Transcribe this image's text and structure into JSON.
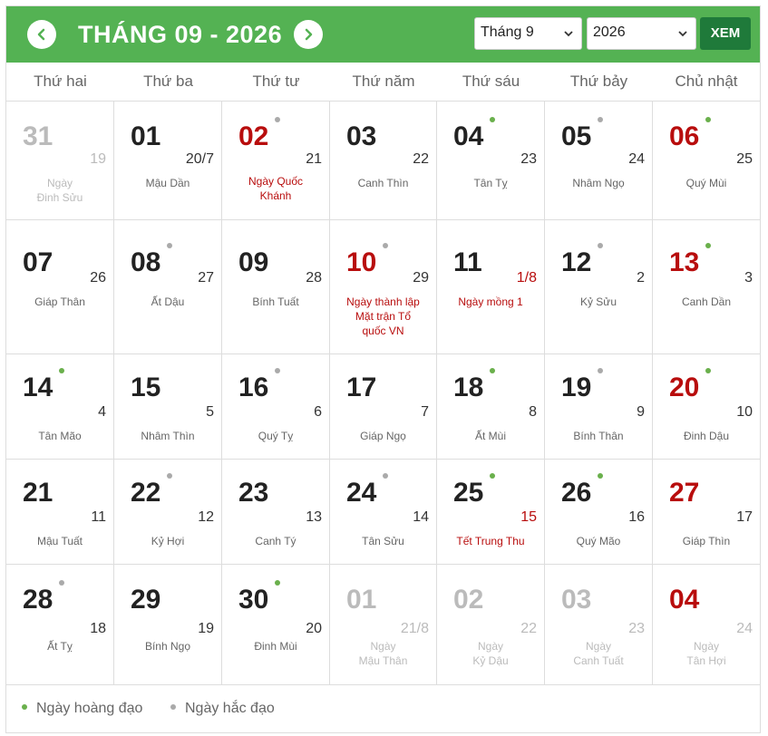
{
  "header": {
    "title": "THÁNG 09 - 2026",
    "month_select": "Tháng 9",
    "year_select": "2026",
    "view_button": "XEM"
  },
  "weekdays": [
    "Thứ hai",
    "Thứ ba",
    "Thứ tư",
    "Thứ năm",
    "Thứ sáu",
    "Thứ bảy",
    "Chủ nhật"
  ],
  "weeks": [
    [
      {
        "solar": "31",
        "lunar": "19",
        "canchi": [
          "Ngày",
          "Đinh Sửu"
        ],
        "out": true
      },
      {
        "solar": "01",
        "lunar": "20/7",
        "canchi": [
          "Mậu Dần"
        ]
      },
      {
        "solar": "02",
        "lunar": "21",
        "canchi": [
          "Ngày Quốc",
          "Khánh"
        ],
        "red": true,
        "dot": "bad",
        "holiday": true
      },
      {
        "solar": "03",
        "lunar": "22",
        "canchi": [
          "Canh Thìn"
        ]
      },
      {
        "solar": "04",
        "lunar": "23",
        "canchi": [
          "Tân Tỵ"
        ],
        "dot": "good"
      },
      {
        "solar": "05",
        "lunar": "24",
        "canchi": [
          "Nhâm Ngọ"
        ],
        "dot": "bad"
      },
      {
        "solar": "06",
        "lunar": "25",
        "canchi": [
          "Quý Mùi"
        ],
        "red": true,
        "dot": "good"
      }
    ],
    [
      {
        "solar": "07",
        "lunar": "26",
        "canchi": [
          "Giáp Thân"
        ]
      },
      {
        "solar": "08",
        "lunar": "27",
        "canchi": [
          "Ất Dậu"
        ],
        "dot": "bad"
      },
      {
        "solar": "09",
        "lunar": "28",
        "canchi": [
          "Bính Tuất"
        ]
      },
      {
        "solar": "10",
        "lunar": "29",
        "canchi": [
          "Ngày thành lập",
          "Mặt trận Tổ",
          "quốc VN"
        ],
        "red": true,
        "dot": "bad",
        "holiday": true
      },
      {
        "solar": "11",
        "lunar": "1/8",
        "canchi": [
          "Ngày mồng 1"
        ],
        "lunar_red": true,
        "holiday": true
      },
      {
        "solar": "12",
        "lunar": "2",
        "canchi": [
          "Kỷ Sửu"
        ],
        "dot": "bad"
      },
      {
        "solar": "13",
        "lunar": "3",
        "canchi": [
          "Canh Dần"
        ],
        "red": true,
        "dot": "good"
      }
    ],
    [
      {
        "solar": "14",
        "lunar": "4",
        "canchi": [
          "Tân Mão"
        ],
        "dot": "good"
      },
      {
        "solar": "15",
        "lunar": "5",
        "canchi": [
          "Nhâm Thìn"
        ]
      },
      {
        "solar": "16",
        "lunar": "6",
        "canchi": [
          "Quý Tỵ"
        ],
        "dot": "bad"
      },
      {
        "solar": "17",
        "lunar": "7",
        "canchi": [
          "Giáp Ngọ"
        ]
      },
      {
        "solar": "18",
        "lunar": "8",
        "canchi": [
          "Ất Mùi"
        ],
        "dot": "good"
      },
      {
        "solar": "19",
        "lunar": "9",
        "canchi": [
          "Bính Thân"
        ],
        "dot": "bad"
      },
      {
        "solar": "20",
        "lunar": "10",
        "canchi": [
          "Đinh Dậu"
        ],
        "red": true,
        "dot": "good"
      }
    ],
    [
      {
        "solar": "21",
        "lunar": "11",
        "canchi": [
          "Mậu Tuất"
        ]
      },
      {
        "solar": "22",
        "lunar": "12",
        "canchi": [
          "Kỷ Hợi"
        ],
        "dot": "bad"
      },
      {
        "solar": "23",
        "lunar": "13",
        "canchi": [
          "Canh Tý"
        ]
      },
      {
        "solar": "24",
        "lunar": "14",
        "canchi": [
          "Tân Sửu"
        ],
        "dot": "bad"
      },
      {
        "solar": "25",
        "lunar": "15",
        "canchi": [
          "Tết Trung Thu"
        ],
        "dot": "good",
        "lunar_red": true,
        "holiday": true
      },
      {
        "solar": "26",
        "lunar": "16",
        "canchi": [
          "Quý Mão"
        ],
        "dot": "good"
      },
      {
        "solar": "27",
        "lunar": "17",
        "canchi": [
          "Giáp Thìn"
        ],
        "red": true
      }
    ],
    [
      {
        "solar": "28",
        "lunar": "18",
        "canchi": [
          "Ất Tỵ"
        ],
        "dot": "bad"
      },
      {
        "solar": "29",
        "lunar": "19",
        "canchi": [
          "Bính Ngọ"
        ]
      },
      {
        "solar": "30",
        "lunar": "20",
        "canchi": [
          "Đinh Mùi"
        ],
        "dot": "good"
      },
      {
        "solar": "01",
        "lunar": "21/8",
        "canchi": [
          "Ngày",
          "Mậu Thân"
        ],
        "out": true
      },
      {
        "solar": "02",
        "lunar": "22",
        "canchi": [
          "Ngày",
          "Kỷ Dậu"
        ],
        "out": true
      },
      {
        "solar": "03",
        "lunar": "23",
        "canchi": [
          "Ngày",
          "Canh Tuất"
        ],
        "out": true
      },
      {
        "solar": "04",
        "lunar": "24",
        "canchi": [
          "Ngày",
          "Tân Hợi"
        ],
        "out": true,
        "red": true
      }
    ]
  ],
  "legend": {
    "good_label": "Ngày hoàng đạo",
    "bad_label": "Ngày hắc đạo"
  },
  "colors": {
    "header_bg": "#54b253",
    "button_bg": "#1f7a3a",
    "holiday_red": "#b80d0d",
    "good_dot": "#6ab04c",
    "bad_dot": "#aaaaaa"
  }
}
